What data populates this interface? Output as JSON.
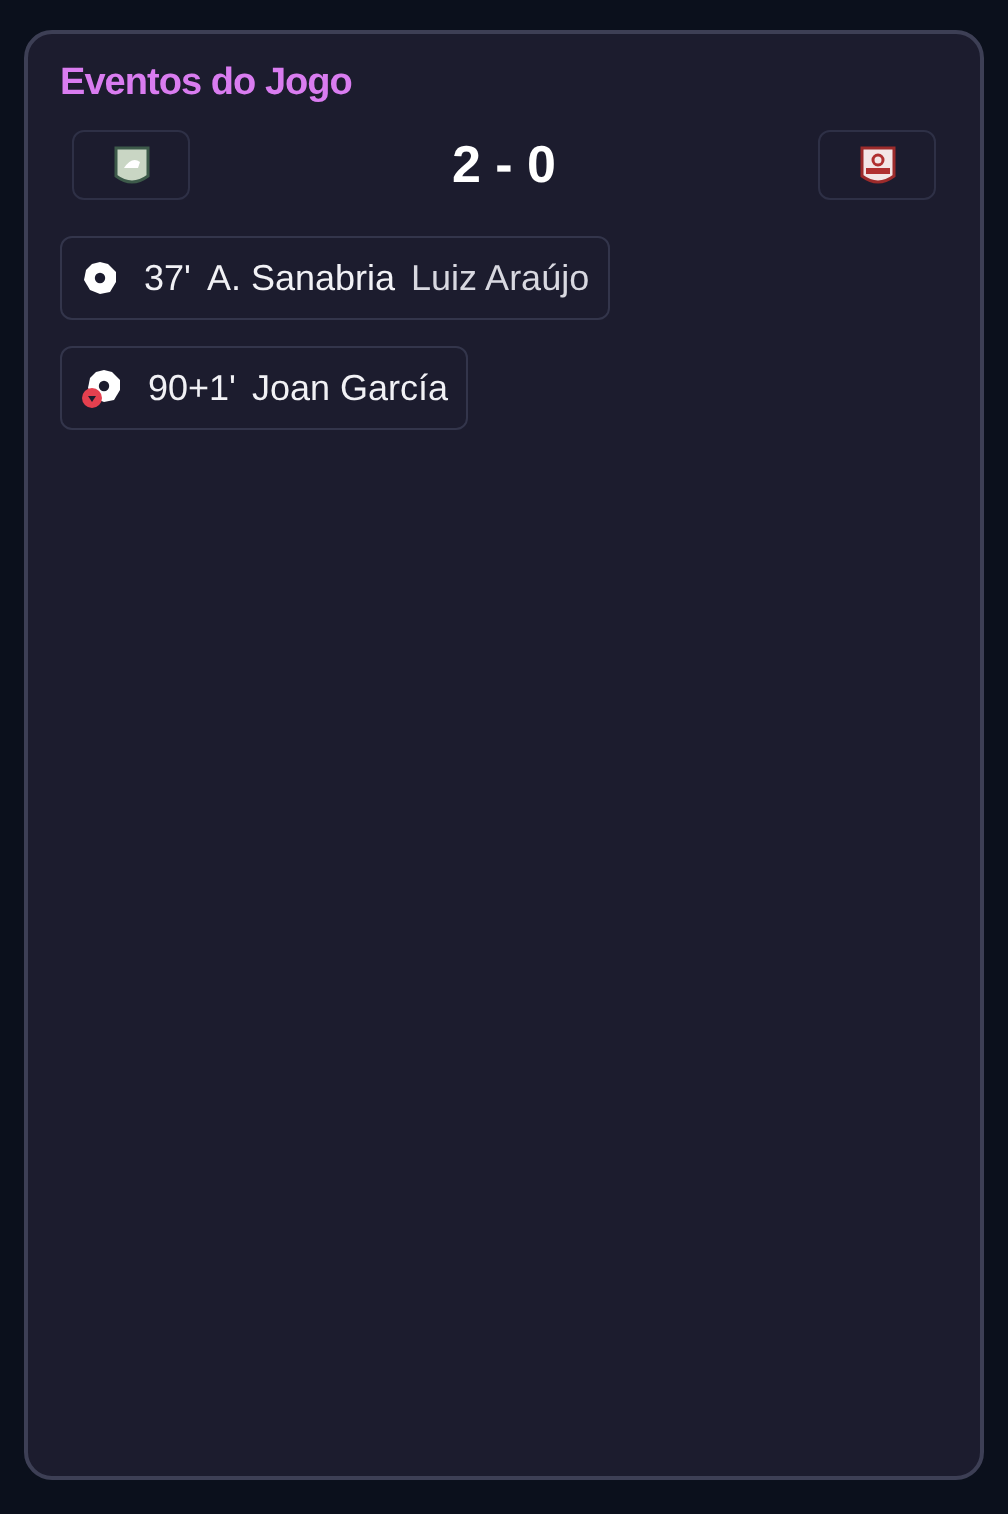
{
  "title": "Eventos do Jogo",
  "score": "2 - 0",
  "events": [
    {
      "kind": "goal",
      "minute": "37'",
      "player": "A. Sanabria",
      "assist": "Luiz Araújo"
    },
    {
      "kind": "own_goal",
      "minute": "90+1'",
      "player": "Joan García"
    }
  ]
}
